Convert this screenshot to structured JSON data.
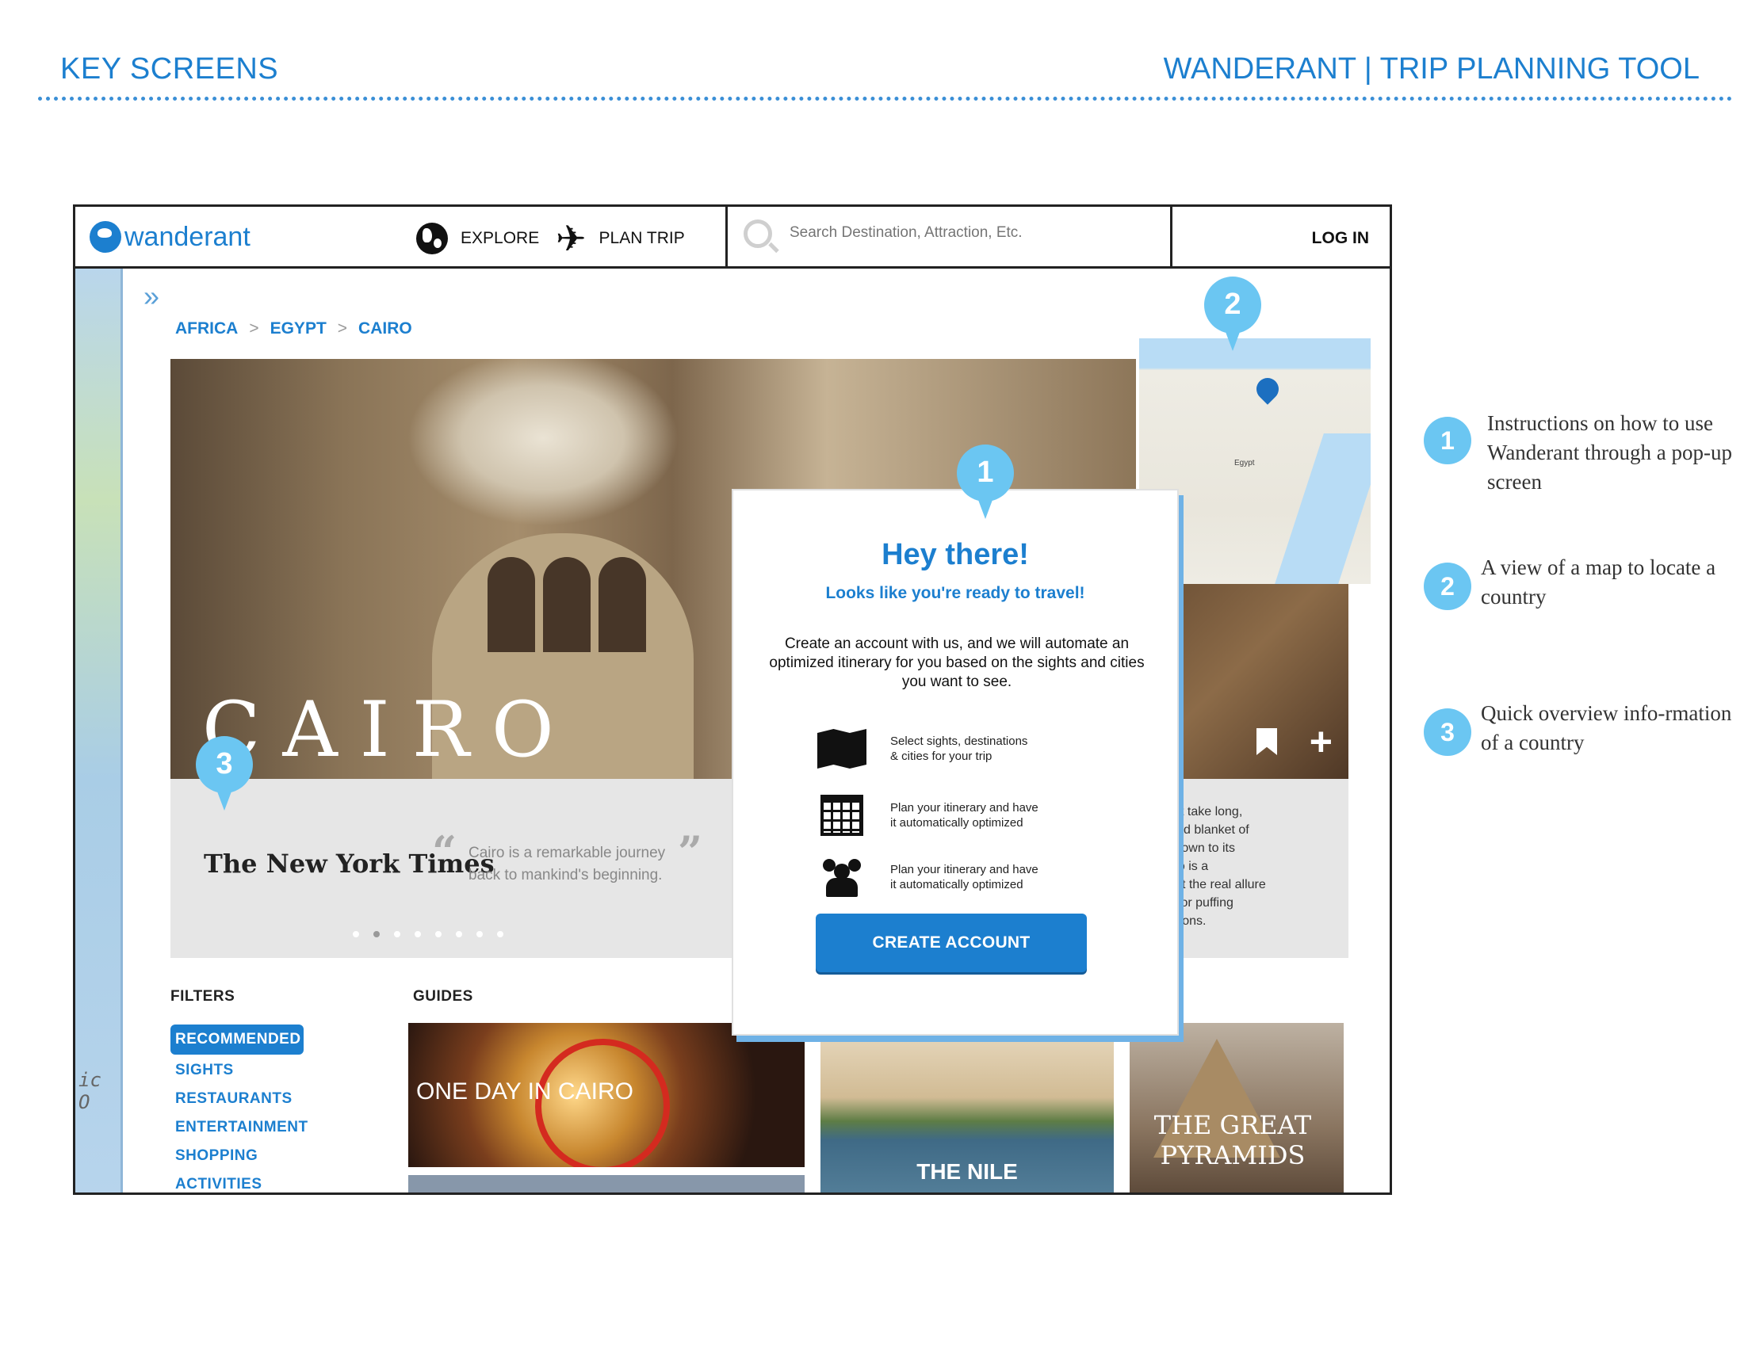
{
  "page": {
    "section_title": "KEY SCREENS",
    "project_title": "WANDERANT | TRIP PLANNING TOOL"
  },
  "nav": {
    "logo_text": "wanderant",
    "explore_label": "EXPLORE",
    "plan_trip_label": "PLAN TRIP",
    "search_placeholder": "Search Destination, Attraction, Etc.",
    "login_label": "LOG IN"
  },
  "breadcrumb": {
    "items": [
      "AFRICA",
      "EGYPT",
      "CAIRO"
    ],
    "separator": ">"
  },
  "hero": {
    "title": "CAIRO",
    "press_source": "The New York Times",
    "quote": "Cairo is a remarkable journey back to mankind's beginning.",
    "slide_count": 8,
    "active_slide": 2
  },
  "map": {
    "label": "Egypt"
  },
  "side_card": {
    "text": "It doesn't take long,\nwkers and blanket of\npolis. Known to its\nern Cairo is a\nstory. But the real allure\nary shai or puffing\nhas for eons."
  },
  "filters": {
    "heading": "FILTERS",
    "items": [
      "RECOMMENDED",
      "SIGHTS",
      "RESTAURANTS",
      "ENTERTAINMENT",
      "SHOPPING",
      "ACTIVITIES"
    ],
    "active": "RECOMMENDED"
  },
  "guides": {
    "heading": "GUIDES",
    "items": [
      "ONE DAY IN CAIRO",
      "THE NILE",
      "THE GREAT PYRAMIDS"
    ]
  },
  "popup": {
    "title": "Hey there!",
    "subtitle": "Looks like you're ready to travel!",
    "body": "Create an account with us, and we will automate an optimized itinerary for you based on the sights and cities you want to see.",
    "steps": [
      {
        "icon": "map-icon",
        "text": "Select sights, destinations\n& cities for your trip"
      },
      {
        "icon": "calendar-icon",
        "text": "Plan your itinerary and have\nit automatically optimized"
      },
      {
        "icon": "people-icon",
        "text": "Plan your itinerary and have\nit automatically optimized"
      }
    ],
    "cta_label": "CREATE ACCOUNT"
  },
  "markers": [
    "1",
    "2",
    "3"
  ],
  "annotations": [
    {
      "number": "1",
      "text": "Instructions on how to use Wanderant through a pop-up screen"
    },
    {
      "number": "2",
      "text": "A view of a map to locate a country"
    },
    {
      "number": "3",
      "text": "Quick overview info-rmation of a country"
    }
  ],
  "colors": {
    "brand_blue": "#1c7fcf",
    "marker_blue": "#6bc6f2",
    "panel_gray": "#e6e6e6"
  }
}
